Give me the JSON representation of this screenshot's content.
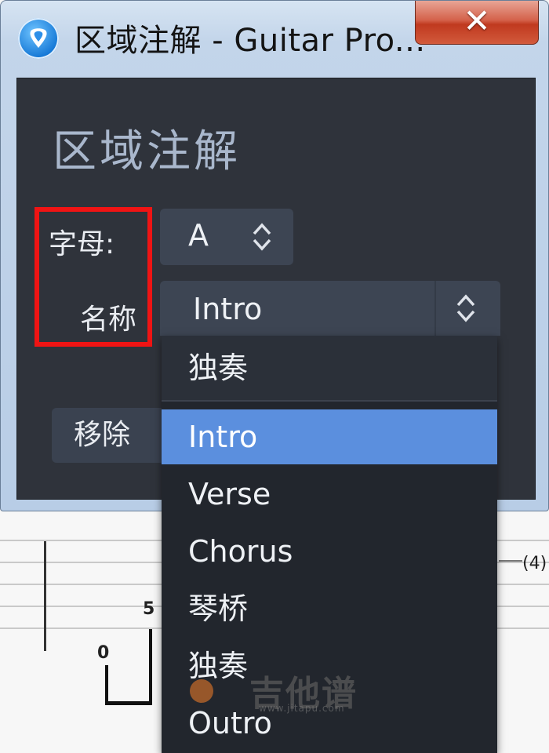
{
  "window": {
    "title": "区域注解 - Guitar Pro...",
    "close_label": "✕"
  },
  "dialog": {
    "heading": "区域注解",
    "letter_label": "字母:",
    "letter_value": "A",
    "name_label": "名称",
    "name_value": "Intro",
    "remove_label": "移除"
  },
  "dropdown": {
    "top_item": "独奏",
    "items": [
      {
        "label": "Intro",
        "selected": true
      },
      {
        "label": "Verse",
        "selected": false
      },
      {
        "label": "Chorus",
        "selected": false
      },
      {
        "label": "琴桥",
        "selected": false
      },
      {
        "label": "独奏",
        "selected": false
      },
      {
        "label": "Outro",
        "selected": false
      }
    ]
  },
  "staff": {
    "fret_top": "5",
    "fret_bottom": "0",
    "right_annotation": "(4)"
  },
  "watermark": {
    "text": "吉他谱",
    "sub": "www.jitapu.com"
  },
  "colors": {
    "dialog_bg": "#2f333b",
    "selected": "#5b8fde",
    "highlight": "#f01414"
  },
  "icons": {
    "app": "guitar-pick-icon",
    "close": "close-icon",
    "spin": "spinner-arrows-icon"
  }
}
